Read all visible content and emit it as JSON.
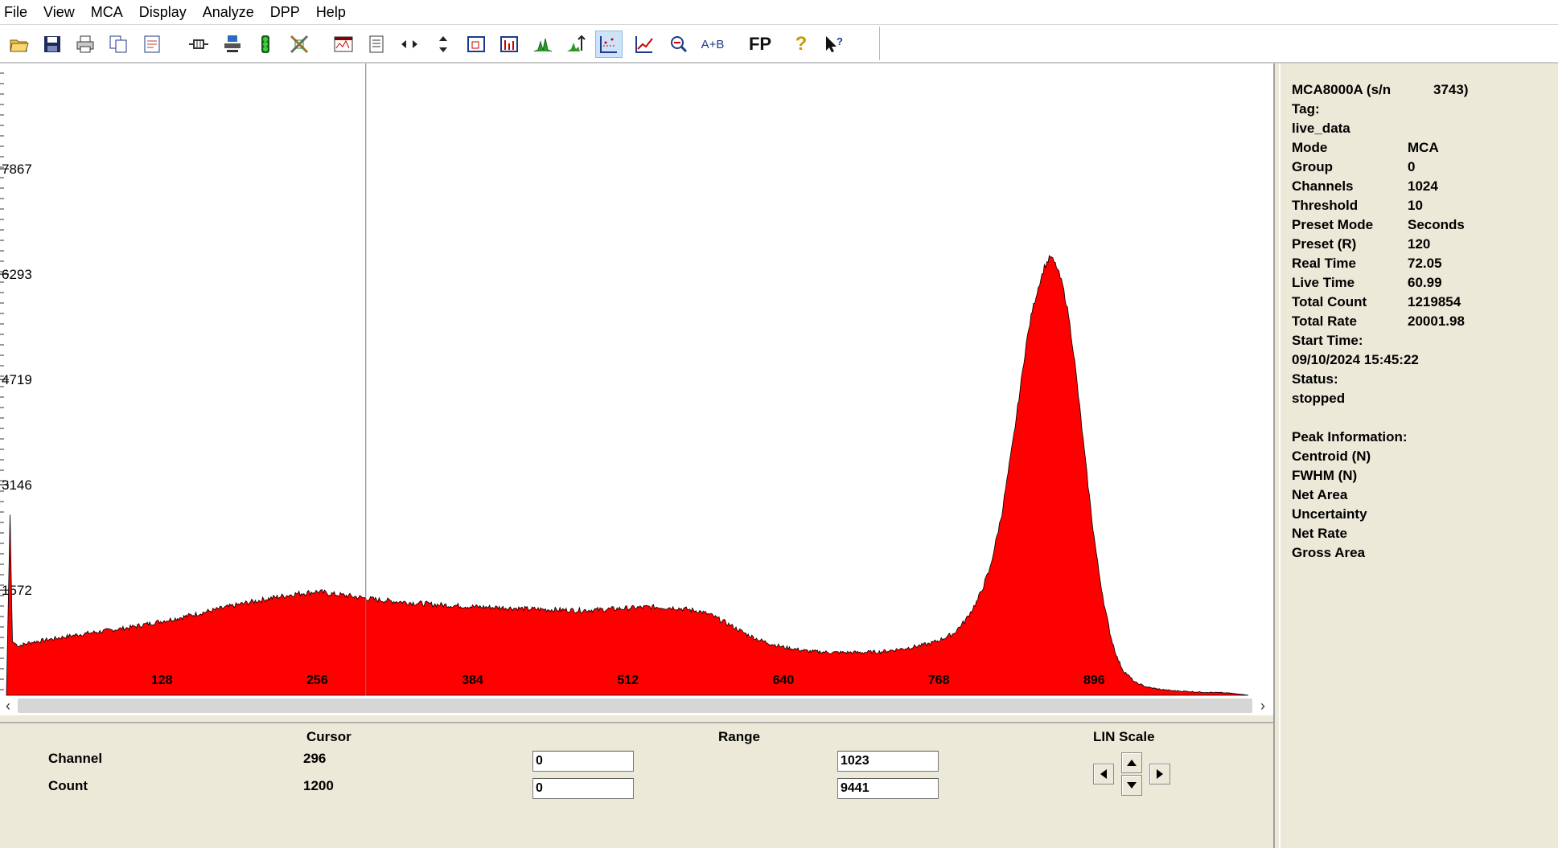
{
  "menubar": {
    "items": [
      "File",
      "View",
      "MCA",
      "Display",
      "Analyze",
      "DPP",
      "Help"
    ]
  },
  "toolbar": {
    "buttons": [
      {
        "name": "open-folder-icon",
        "active": false
      },
      {
        "name": "save-icon",
        "active": false
      },
      {
        "name": "print-icon",
        "active": false
      },
      {
        "name": "copy-icon",
        "active": false
      },
      {
        "name": "report-icon",
        "active": false
      },
      {
        "name": "connect-icon",
        "active": false
      },
      {
        "name": "network-device-icon",
        "active": false
      },
      {
        "name": "traffic-light-icon",
        "active": false
      },
      {
        "name": "tools-icon",
        "active": false
      },
      {
        "name": "spectrum-window-icon",
        "active": false
      },
      {
        "name": "document-icon",
        "active": false
      },
      {
        "name": "horizontal-expand-icon",
        "active": false
      },
      {
        "name": "vertical-expand-icon",
        "active": false
      },
      {
        "name": "zoom-box-icon",
        "active": false
      },
      {
        "name": "bar-chart-icon",
        "active": false
      },
      {
        "name": "peak-find-icon",
        "active": false
      },
      {
        "name": "auto-scale-icon",
        "active": false
      },
      {
        "name": "scatter-plot-icon",
        "active": true
      },
      {
        "name": "line-plot-icon",
        "active": false
      },
      {
        "name": "magnify-icon",
        "active": false
      },
      {
        "name": "a-plus-b-icon",
        "active": false
      },
      {
        "name": "fp-icon",
        "active": false
      },
      {
        "name": "help-icon",
        "active": false
      },
      {
        "name": "context-help-icon",
        "active": false
      }
    ],
    "a_plus_b_text": "A+B",
    "fp_text": "FP"
  },
  "chart_data": {
    "type": "area",
    "color": "#ff0000",
    "x_tick_labels": [
      "128",
      "256",
      "384",
      "512",
      "640",
      "768",
      "896"
    ],
    "y_tick_labels": [
      "7867",
      "6293",
      "4719",
      "3146",
      "1572"
    ],
    "xlim": [
      0,
      1023
    ],
    "ylim": [
      0,
      9441
    ],
    "cursor_channel": 296,
    "x": [
      0,
      3,
      5,
      10,
      20,
      40,
      60,
      80,
      100,
      120,
      140,
      160,
      180,
      200,
      220,
      240,
      256,
      270,
      285,
      296,
      310,
      330,
      350,
      370,
      390,
      410,
      430,
      450,
      470,
      490,
      510,
      530,
      550,
      570,
      580,
      590,
      600,
      610,
      620,
      630,
      640,
      660,
      680,
      700,
      720,
      740,
      760,
      768,
      780,
      790,
      800,
      810,
      820,
      830,
      840,
      845,
      850,
      855,
      860,
      865,
      870,
      875,
      880,
      885,
      890,
      895,
      900,
      905,
      910,
      915,
      920,
      930,
      940,
      950,
      960,
      980,
      1000,
      1010,
      1023
    ],
    "values": [
      0,
      2700,
      800,
      740,
      790,
      850,
      910,
      960,
      1010,
      1080,
      1150,
      1230,
      1310,
      1390,
      1460,
      1520,
      1550,
      1510,
      1480,
      1450,
      1420,
      1390,
      1360,
      1340,
      1320,
      1310,
      1290,
      1280,
      1270,
      1280,
      1300,
      1320,
      1310,
      1260,
      1200,
      1110,
      1010,
      910,
      830,
      770,
      720,
      660,
      640,
      640,
      650,
      700,
      770,
      820,
      920,
      1120,
      1420,
      1880,
      2720,
      3900,
      5250,
      5750,
      6100,
      6400,
      6560,
      6410,
      6130,
      5680,
      4980,
      4150,
      3300,
      2500,
      1830,
      1290,
      860,
      560,
      370,
      190,
      120,
      90,
      70,
      50,
      40,
      30,
      0
    ]
  },
  "info": {
    "device": "MCA8000A (s/n",
    "serial": "3743)",
    "tag_label": "Tag:",
    "tag_value": "live_data",
    "rows": [
      {
        "label": "Mode",
        "value": "MCA"
      },
      {
        "label": "Group",
        "value": "0"
      },
      {
        "label": "Channels",
        "value": "1024"
      },
      {
        "label": "Threshold",
        "value": "10"
      },
      {
        "label": "Preset Mode",
        "value": "Seconds"
      },
      {
        "label": "Preset (R)",
        "value": "120"
      },
      {
        "label": "Real Time",
        "value": "72.05"
      },
      {
        "label": "Live Time",
        "value": "60.99"
      },
      {
        "label": "Total Count",
        "value": "1219854"
      },
      {
        "label": "Total Rate",
        "value": "20001.98"
      }
    ],
    "start_time_label": "Start Time:",
    "start_time_value": "09/10/2024 15:45:22",
    "status_label": "Status:",
    "status_value": "stopped",
    "peak_header": "Peak Information:",
    "peak_items": [
      "Centroid (N)",
      "FWHM (N)",
      "Net Area",
      "Uncertainty",
      "Net Rate",
      "Gross Area"
    ]
  },
  "bottom": {
    "cursor_header": "Cursor",
    "range_header": "Range",
    "scale_header": "LIN Scale",
    "channel_label": "Channel",
    "count_label": "Count",
    "cursor_channel": "296",
    "cursor_count": "1200",
    "range_channel_min": "0",
    "range_channel_max": "1023",
    "range_count_min": "0",
    "range_count_max": "9441"
  }
}
